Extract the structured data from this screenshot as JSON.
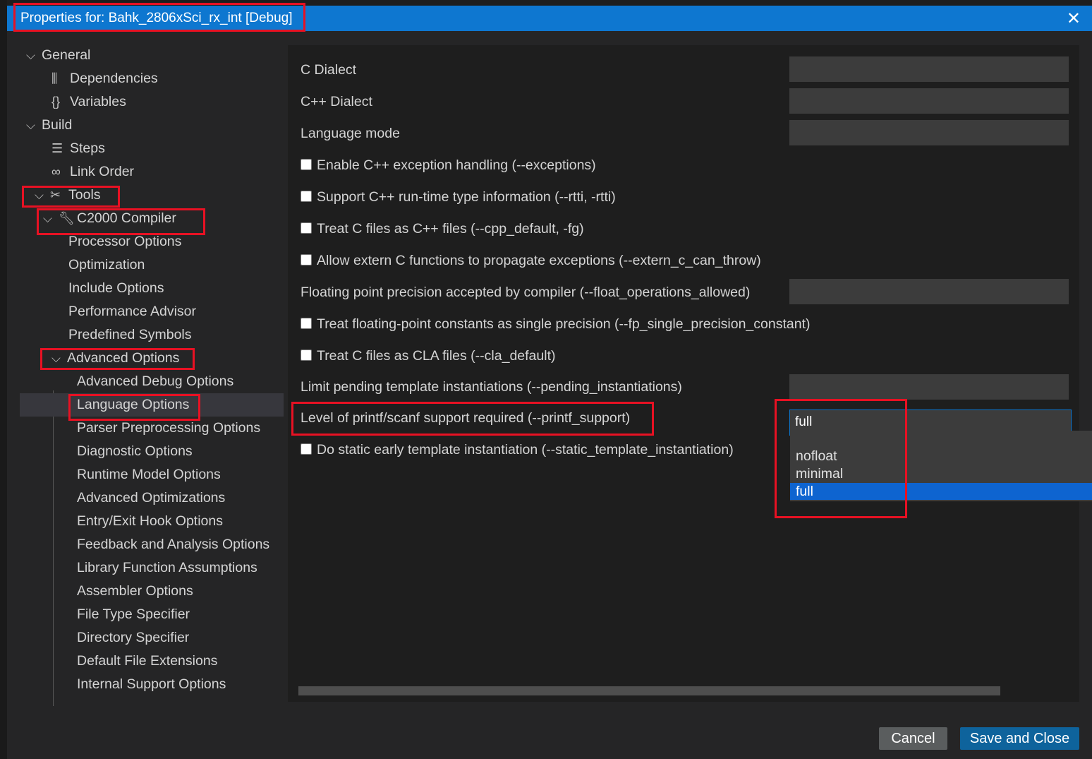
{
  "window": {
    "title": "Properties for: Bahk_2806xSci_rx_int [Debug]",
    "close_icon": "close-icon"
  },
  "tree": {
    "general": "General",
    "dependencies": "Dependencies",
    "variables": "Variables",
    "build": "Build",
    "steps": "Steps",
    "link_order": "Link Order",
    "tools": "Tools",
    "compiler": "C2000 Compiler",
    "processor_options": "Processor Options",
    "optimization": "Optimization",
    "include_options": "Include Options",
    "performance_advisor": "Performance Advisor",
    "predefined_symbols": "Predefined Symbols",
    "advanced_options": "Advanced Options",
    "advanced_children": [
      "Advanced Debug Options",
      "Language Options",
      "Parser Preprocessing Options",
      "Diagnostic Options",
      "Runtime Model Options",
      "Advanced Optimizations",
      "Entry/Exit Hook Options",
      "Feedback and Analysis Options",
      "Library Function Assumptions",
      "Assembler Options",
      "File Type Specifier",
      "Directory Specifier",
      "Default File Extensions",
      "Internal Support Options"
    ],
    "selected": "Language Options"
  },
  "settings": {
    "c_dialect": "C Dialect",
    "cpp_dialect": "C++ Dialect",
    "language_mode": "Language mode",
    "exceptions": "Enable C++ exception handling (--exceptions)",
    "rtti": "Support C++ run-time type information (--rtti, -rtti)",
    "cpp_default": "Treat C files as C++ files (--cpp_default, -fg)",
    "extern_c": "Allow extern C functions to propagate exceptions (--extern_c_can_throw)",
    "float_ops": "Floating point precision accepted by compiler (--float_operations_allowed)",
    "fp_single": "Treat floating-point constants as single precision (--fp_single_precision_constant)",
    "cla_default": "Treat C files as CLA files (--cla_default)",
    "pending_inst": "Limit pending template instantiations (--pending_instantiations)",
    "printf_support": "Level of printf/scanf support required (--printf_support)",
    "printf_value": "full",
    "printf_options": [
      "nofloat",
      "minimal",
      "full"
    ],
    "static_template": "Do static early template instantiation (--static_template_instantiation)"
  },
  "buttons": {
    "cancel": "Cancel",
    "save_close": "Save and Close"
  },
  "colors": {
    "accent": "#0e77d0",
    "highlight_box": "#e81123",
    "selected_option": "#0e64d0"
  }
}
